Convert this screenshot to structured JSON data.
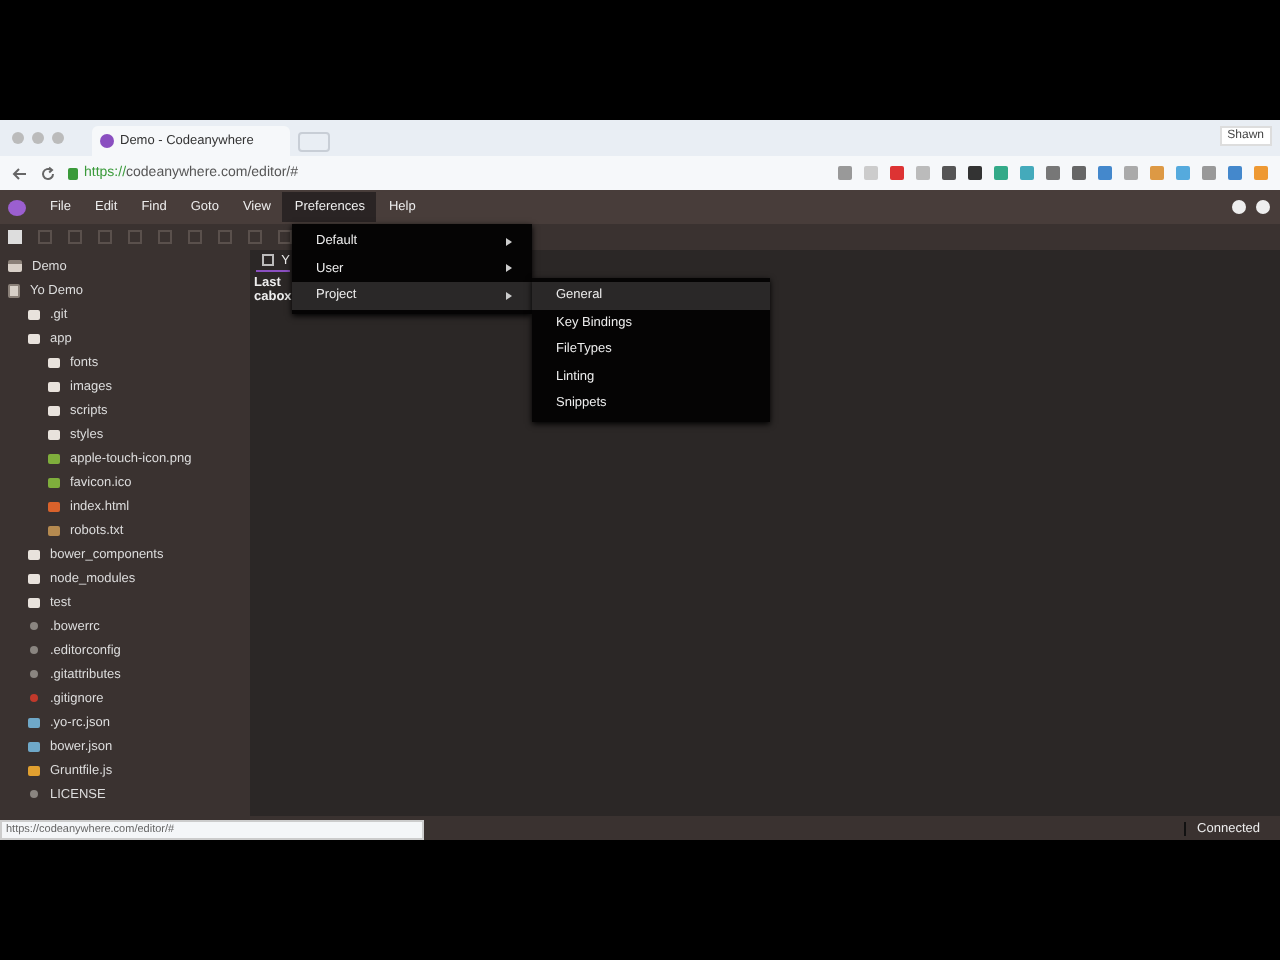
{
  "browser": {
    "tab_title": "Demo - Codeanywhere",
    "url_scheme": "https://",
    "url_rest": "codeanywhere.com/editor/#",
    "user": "Shawn"
  },
  "menu_bar": [
    {
      "label": "File",
      "selected": false
    },
    {
      "label": "Edit",
      "selected": false
    },
    {
      "label": "Find",
      "selected": false
    },
    {
      "label": "Goto",
      "selected": false
    },
    {
      "label": "View",
      "selected": false
    },
    {
      "label": "Preferences",
      "selected": true
    },
    {
      "label": "Help",
      "selected": false
    }
  ],
  "preferences_menu": [
    {
      "label": "Default",
      "selected": false
    },
    {
      "label": "User",
      "selected": false
    },
    {
      "label": "Project",
      "selected": true
    }
  ],
  "project_submenu": [
    {
      "label": "General",
      "selected": true
    },
    {
      "label": "Key Bindings",
      "selected": false
    },
    {
      "label": "FileTypes",
      "selected": false
    },
    {
      "label": "Linting",
      "selected": false
    },
    {
      "label": "Snippets",
      "selected": false
    }
  ],
  "sidebar": {
    "items": [
      {
        "label": "Demo",
        "kind": "server"
      },
      {
        "label": "Yo Demo",
        "kind": "project",
        "children": [
          {
            "label": ".git",
            "kind": "folder"
          },
          {
            "label": "app",
            "kind": "open-folder",
            "children": [
              {
                "label": "fonts",
                "kind": "folder"
              },
              {
                "label": "images",
                "kind": "folder"
              },
              {
                "label": "scripts",
                "kind": "folder"
              },
              {
                "label": "styles",
                "kind": "folder"
              },
              {
                "label": "apple-touch-icon.png",
                "kind": "image"
              },
              {
                "label": "favicon.ico",
                "kind": "image"
              },
              {
                "label": "index.html",
                "kind": "html"
              },
              {
                "label": "robots.txt",
                "kind": "text"
              }
            ]
          },
          {
            "label": "bower_components",
            "kind": "folder"
          },
          {
            "label": "node_modules",
            "kind": "folder"
          },
          {
            "label": "test",
            "kind": "folder"
          },
          {
            "label": ".bowerrc",
            "kind": "file"
          },
          {
            "label": ".editorconfig",
            "kind": "file"
          },
          {
            "label": ".gitattributes",
            "kind": "file"
          },
          {
            "label": ".gitignore",
            "kind": "git"
          },
          {
            "label": ".yo-rc.json",
            "kind": "json"
          },
          {
            "label": "bower.json",
            "kind": "json"
          },
          {
            "label": "Gruntfile.js",
            "kind": "js"
          },
          {
            "label": "LICENSE",
            "kind": "file"
          }
        ]
      }
    ]
  },
  "editor": {
    "tab_label": "Y",
    "lines": [
      "Last",
      "cabox"
    ]
  },
  "link_preview": "https://codeanywhere.com/editor/#",
  "status_bar": {
    "status": "Connected"
  }
}
